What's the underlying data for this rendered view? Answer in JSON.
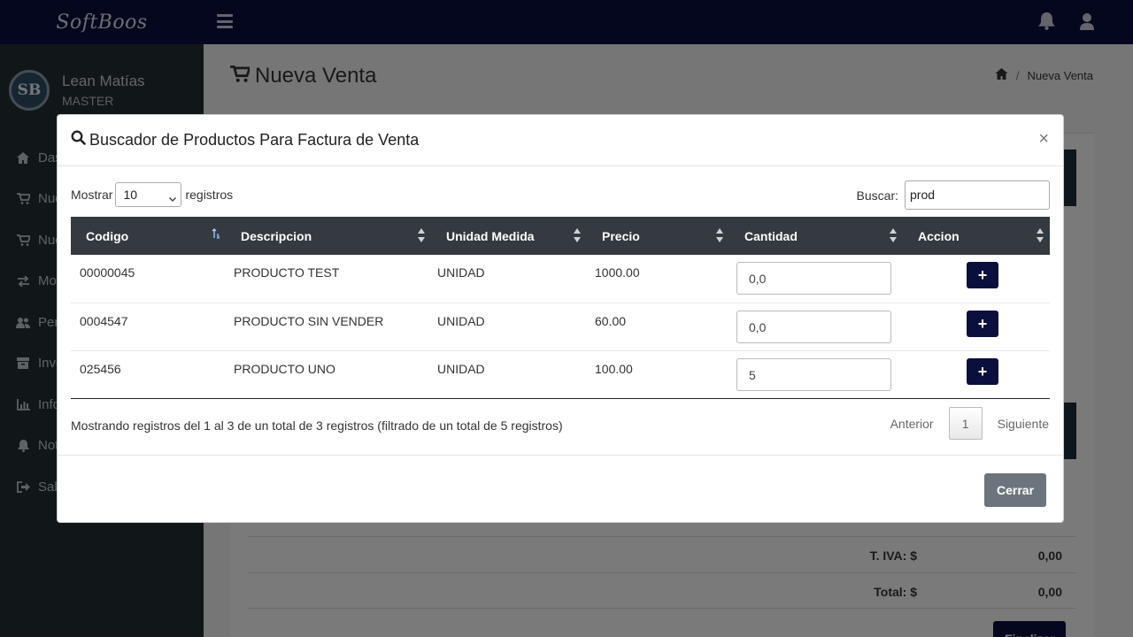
{
  "brand": "SoftBoos",
  "user": {
    "avatar_initials": "SB",
    "name": "Lean Matías",
    "role": "MASTER"
  },
  "sidebar": {
    "items": [
      {
        "label": "Dashboard",
        "icon": "home-icon"
      },
      {
        "label": "Nueva Venta",
        "icon": "cart-icon"
      },
      {
        "label": "Nueva Compra",
        "icon": "cart-icon"
      },
      {
        "label": "Movimientos",
        "icon": "exchange-icon"
      },
      {
        "label": "Personas",
        "icon": "users-icon"
      },
      {
        "label": "Inventario",
        "icon": "archive-icon"
      },
      {
        "label": "Informes",
        "icon": "bar-chart-icon"
      },
      {
        "label": "Notificaciones",
        "icon": "bell-icon"
      },
      {
        "label": "Salir",
        "icon": "sign-out-icon"
      }
    ]
  },
  "header": {
    "icons": [
      "hamburger-icon",
      "bell-icon",
      "user-icon"
    ]
  },
  "page": {
    "title": "Nueva Venta",
    "breadcrumb": {
      "current": "Nueva Venta"
    }
  },
  "totals": {
    "iva_label": "T. IVA: $",
    "iva_value": "0,00",
    "total_label": "Total: $",
    "total_value": "0,00",
    "finalize_label": "Finalizar"
  },
  "modal": {
    "title": "Buscador de Productos Para Factura de Venta",
    "close_label": "×",
    "length_prefix": "Mostrar",
    "length_value": "10",
    "length_suffix": "registros",
    "search_label": "Buscar:",
    "search_value": "prod",
    "columns": [
      "Codigo",
      "Descripcion",
      "Unidad Medida",
      "Precio",
      "Cantidad",
      "Accion"
    ],
    "rows": [
      {
        "codigo": "00000045",
        "descripcion": "PRODUCTO TEST",
        "unidad": "UNIDAD",
        "precio": "1000.00",
        "cantidad": "0,0",
        "accion": "+"
      },
      {
        "codigo": "0004547",
        "descripcion": "PRODUCTO SIN VENDER",
        "unidad": "UNIDAD",
        "precio": "60.00",
        "cantidad": "0,0",
        "accion": "+"
      },
      {
        "codigo": "025456",
        "descripcion": "PRODUCTO UNO",
        "unidad": "UNIDAD",
        "precio": "100.00",
        "cantidad": "5",
        "accion": "+"
      }
    ],
    "info": "Mostrando registros del 1 al 3 de un total de 3 registros (filtrado de un total de 5 registros)",
    "pagination": {
      "previous": "Anterior",
      "current_page": "1",
      "next": "Siguiente"
    },
    "close_button": "Cerrar"
  },
  "colors": {
    "navy": "#0b0f3e",
    "sidebar": "#222d32",
    "table_header": "#343a40",
    "close_button": "#6c757d"
  }
}
